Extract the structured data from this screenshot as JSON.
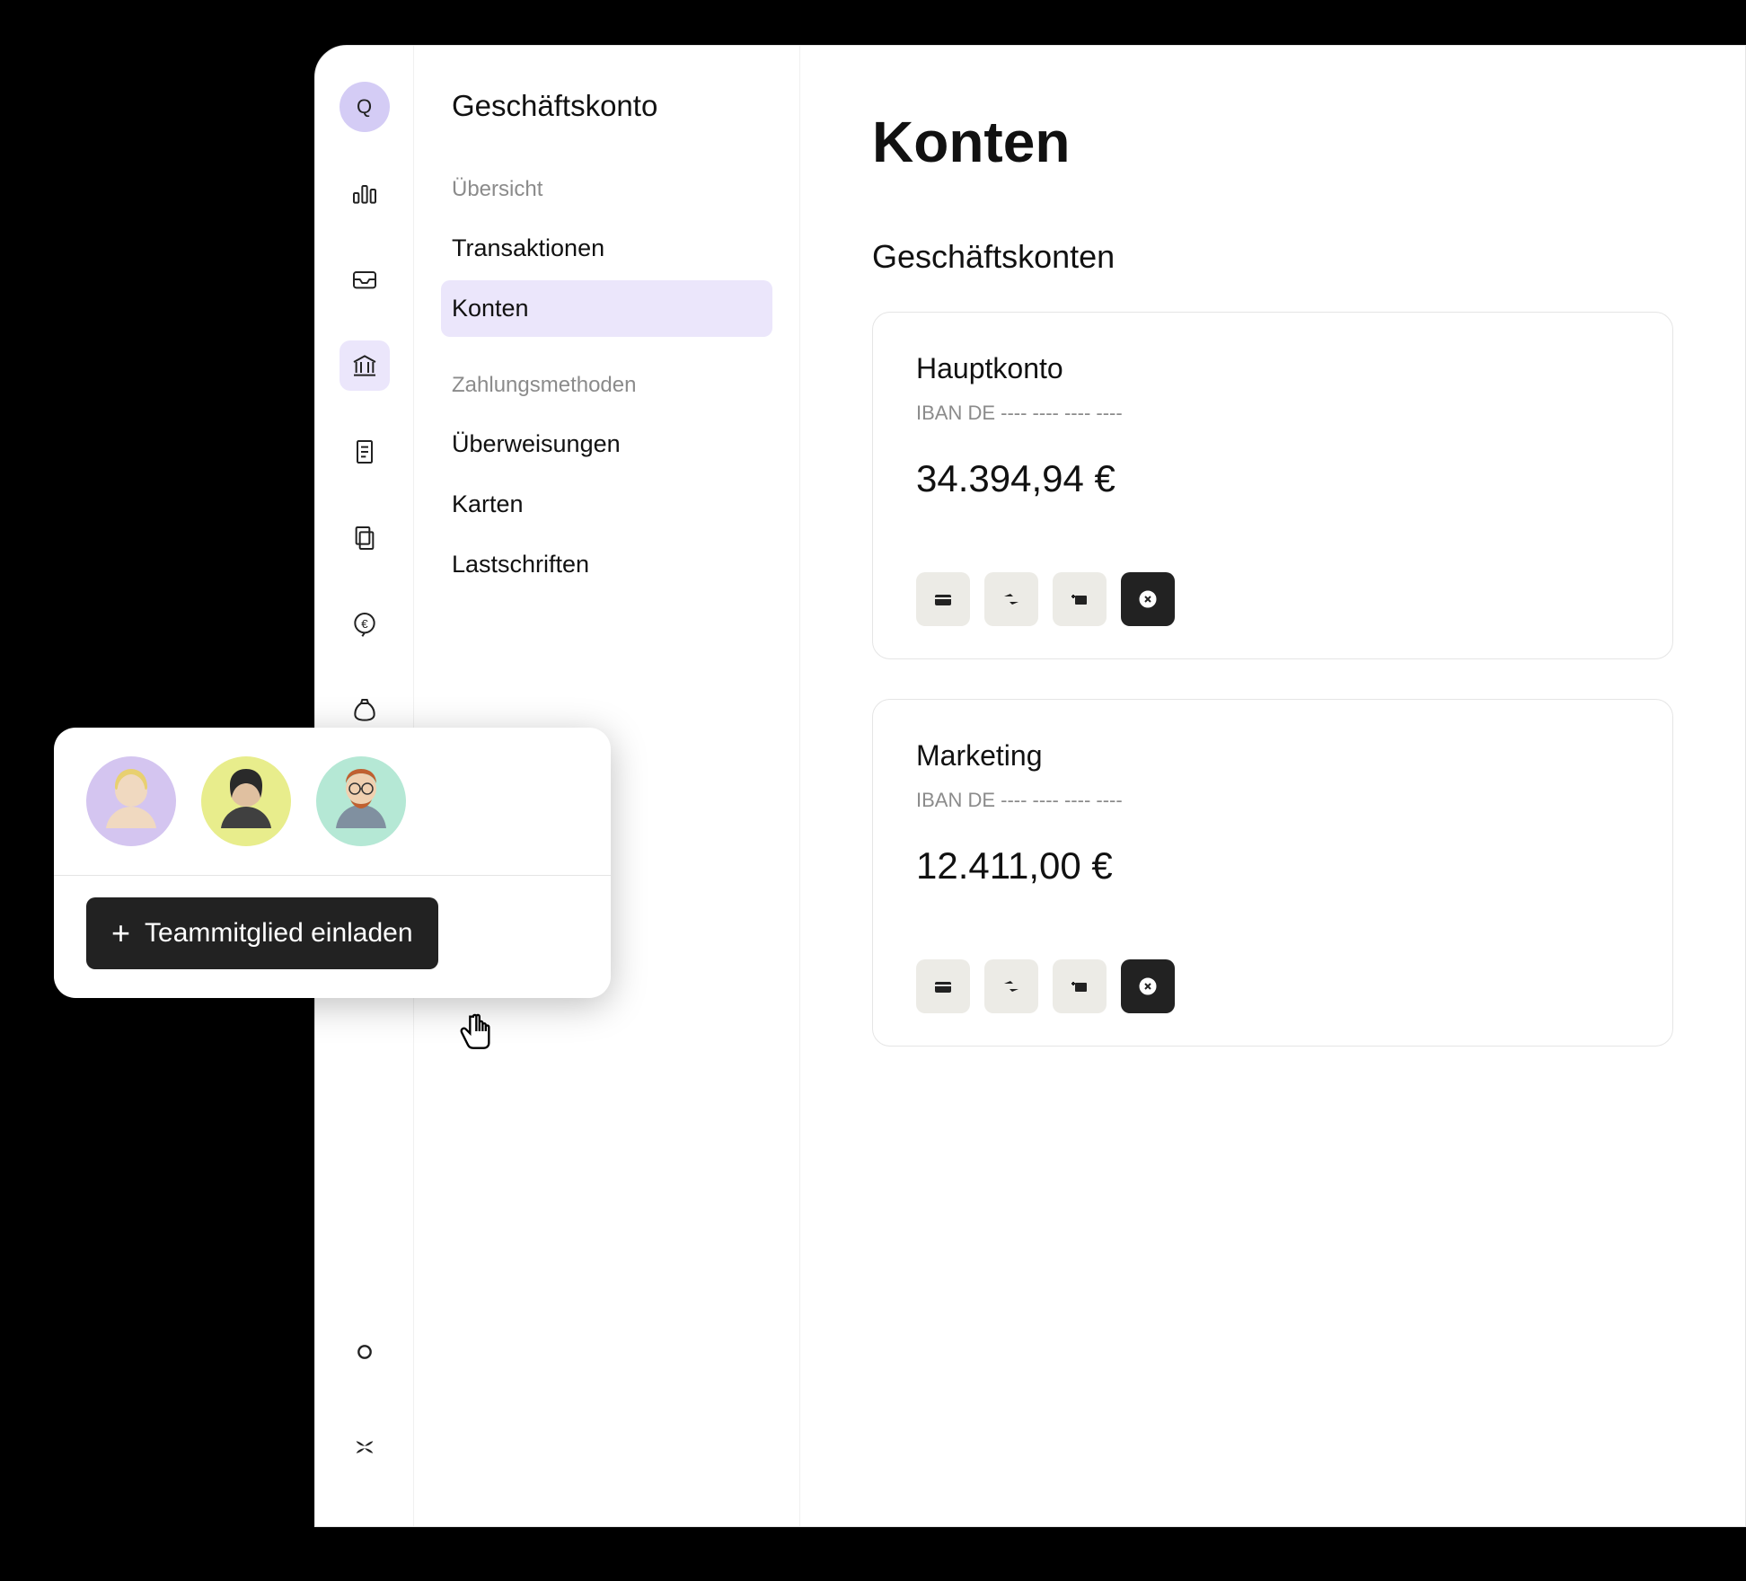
{
  "logo_letter": "Q",
  "sidebar": {
    "title": "Geschäftskonto",
    "section1_label": "Übersicht",
    "section1_items": [
      "Transaktionen",
      "Konten"
    ],
    "section2_label": "Zahlungsmethoden",
    "section2_items": [
      "Überweisungen",
      "Karten",
      "Lastschriften"
    ]
  },
  "main": {
    "title": "Konten",
    "subtitle": "Geschäftskonten",
    "accounts": [
      {
        "name": "Hauptkonto",
        "iban": "IBAN DE ---- ---- ---- ----",
        "balance": "34.394,94 €"
      },
      {
        "name": "Marketing",
        "iban": "IBAN DE ---- ---- ---- ----",
        "balance": "12.411,00 €"
      }
    ]
  },
  "team_popup": {
    "invite_label": "Teammitglied einladen",
    "avatar_colors": [
      "#d4c5f0",
      "#e8ed8c",
      "#b5e8d5"
    ]
  }
}
